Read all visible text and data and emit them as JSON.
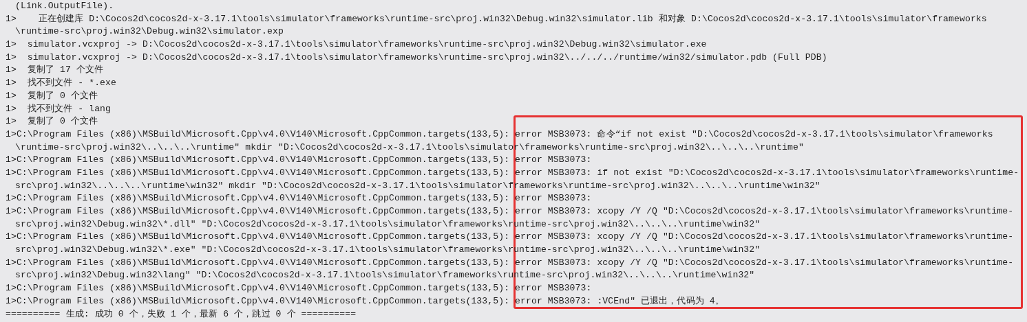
{
  "output_lines": [
    {
      "kind": "continuation",
      "text": "(Link.OutputFile)."
    },
    {
      "kind": "line",
      "text": "1>    正在创建库 D:\\Cocos2d\\cocos2d-x-3.17.1\\tools\\simulator\\frameworks\\runtime-src\\proj.win32\\Debug.win32\\simulator.lib 和对象 D:\\Cocos2d\\cocos2d-x-3.17.1\\tools\\simulator\\frameworks"
    },
    {
      "kind": "continuation",
      "text": "\\runtime-src\\proj.win32\\Debug.win32\\simulator.exp"
    },
    {
      "kind": "line",
      "text": "1>  simulator.vcxproj -> D:\\Cocos2d\\cocos2d-x-3.17.1\\tools\\simulator\\frameworks\\runtime-src\\proj.win32\\Debug.win32\\simulator.exe"
    },
    {
      "kind": "line",
      "text": "1>  simulator.vcxproj -> D:\\Cocos2d\\cocos2d-x-3.17.1\\tools\\simulator\\frameworks\\runtime-src\\proj.win32\\../../../runtime/win32/simulator.pdb (Full PDB)"
    },
    {
      "kind": "line",
      "text": "1>  复制了 17 个文件"
    },
    {
      "kind": "line",
      "text": "1>  找不到文件 - *.exe"
    },
    {
      "kind": "line",
      "text": "1>  复制了 0 个文件"
    },
    {
      "kind": "line",
      "text": "1>  找不到文件 - lang"
    },
    {
      "kind": "line",
      "text": "1>  复制了 0 个文件"
    },
    {
      "kind": "line",
      "text": "1>C:\\Program Files (x86)\\MSBuild\\Microsoft.Cpp\\v4.0\\V140\\Microsoft.CppCommon.targets(133,5): error MSB3073: 命令“if not exist \"D:\\Cocos2d\\cocos2d-x-3.17.1\\tools\\simulator\\frameworks"
    },
    {
      "kind": "continuation",
      "text": "\\runtime-src\\proj.win32\\..\\..\\..\\runtime\" mkdir \"D:\\Cocos2d\\cocos2d-x-3.17.1\\tools\\simulator\\frameworks\\runtime-src\\proj.win32\\..\\..\\..\\runtime\""
    },
    {
      "kind": "line",
      "text": "1>C:\\Program Files (x86)\\MSBuild\\Microsoft.Cpp\\v4.0\\V140\\Microsoft.CppCommon.targets(133,5): error MSB3073:"
    },
    {
      "kind": "line",
      "text": "1>C:\\Program Files (x86)\\MSBuild\\Microsoft.Cpp\\v4.0\\V140\\Microsoft.CppCommon.targets(133,5): error MSB3073: if not exist \"D:\\Cocos2d\\cocos2d-x-3.17.1\\tools\\simulator\\frameworks\\runtime-"
    },
    {
      "kind": "continuation",
      "text": "src\\proj.win32\\..\\..\\..\\runtime\\win32\" mkdir \"D:\\Cocos2d\\cocos2d-x-3.17.1\\tools\\simulator\\frameworks\\runtime-src\\proj.win32\\..\\..\\..\\runtime\\win32\""
    },
    {
      "kind": "line",
      "text": "1>C:\\Program Files (x86)\\MSBuild\\Microsoft.Cpp\\v4.0\\V140\\Microsoft.CppCommon.targets(133,5): error MSB3073:"
    },
    {
      "kind": "line",
      "text": "1>C:\\Program Files (x86)\\MSBuild\\Microsoft.Cpp\\v4.0\\V140\\Microsoft.CppCommon.targets(133,5): error MSB3073: xcopy /Y /Q \"D:\\Cocos2d\\cocos2d-x-3.17.1\\tools\\simulator\\frameworks\\runtime-"
    },
    {
      "kind": "continuation",
      "text": "src\\proj.win32\\Debug.win32\\*.dll\" \"D:\\Cocos2d\\cocos2d-x-3.17.1\\tools\\simulator\\frameworks\\runtime-src\\proj.win32\\..\\..\\..\\runtime\\win32\""
    },
    {
      "kind": "line",
      "text": "1>C:\\Program Files (x86)\\MSBuild\\Microsoft.Cpp\\v4.0\\V140\\Microsoft.CppCommon.targets(133,5): error MSB3073: xcopy /Y /Q \"D:\\Cocos2d\\cocos2d-x-3.17.1\\tools\\simulator\\frameworks\\runtime-"
    },
    {
      "kind": "continuation",
      "text": "src\\proj.win32\\Debug.win32\\*.exe\" \"D:\\Cocos2d\\cocos2d-x-3.17.1\\tools\\simulator\\frameworks\\runtime-src\\proj.win32\\..\\..\\..\\runtime\\win32\""
    },
    {
      "kind": "line",
      "text": "1>C:\\Program Files (x86)\\MSBuild\\Microsoft.Cpp\\v4.0\\V140\\Microsoft.CppCommon.targets(133,5): error MSB3073: xcopy /Y /Q \"D:\\Cocos2d\\cocos2d-x-3.17.1\\tools\\simulator\\frameworks\\runtime-"
    },
    {
      "kind": "continuation",
      "text": "src\\proj.win32\\Debug.win32\\lang\" \"D:\\Cocos2d\\cocos2d-x-3.17.1\\tools\\simulator\\frameworks\\runtime-src\\proj.win32\\..\\..\\..\\runtime\\win32\""
    },
    {
      "kind": "line",
      "text": "1>C:\\Program Files (x86)\\MSBuild\\Microsoft.Cpp\\v4.0\\V140\\Microsoft.CppCommon.targets(133,5): error MSB3073:"
    },
    {
      "kind": "line",
      "text": "1>C:\\Program Files (x86)\\MSBuild\\Microsoft.Cpp\\v4.0\\V140\\Microsoft.CppCommon.targets(133,5): error MSB3073: :VCEnd\" 已退出，代码为 4。"
    },
    {
      "kind": "line",
      "text": "========== 生成: 成功 0 个，失败 1 个，最新 6 个，跳过 0 个 =========="
    }
  ]
}
